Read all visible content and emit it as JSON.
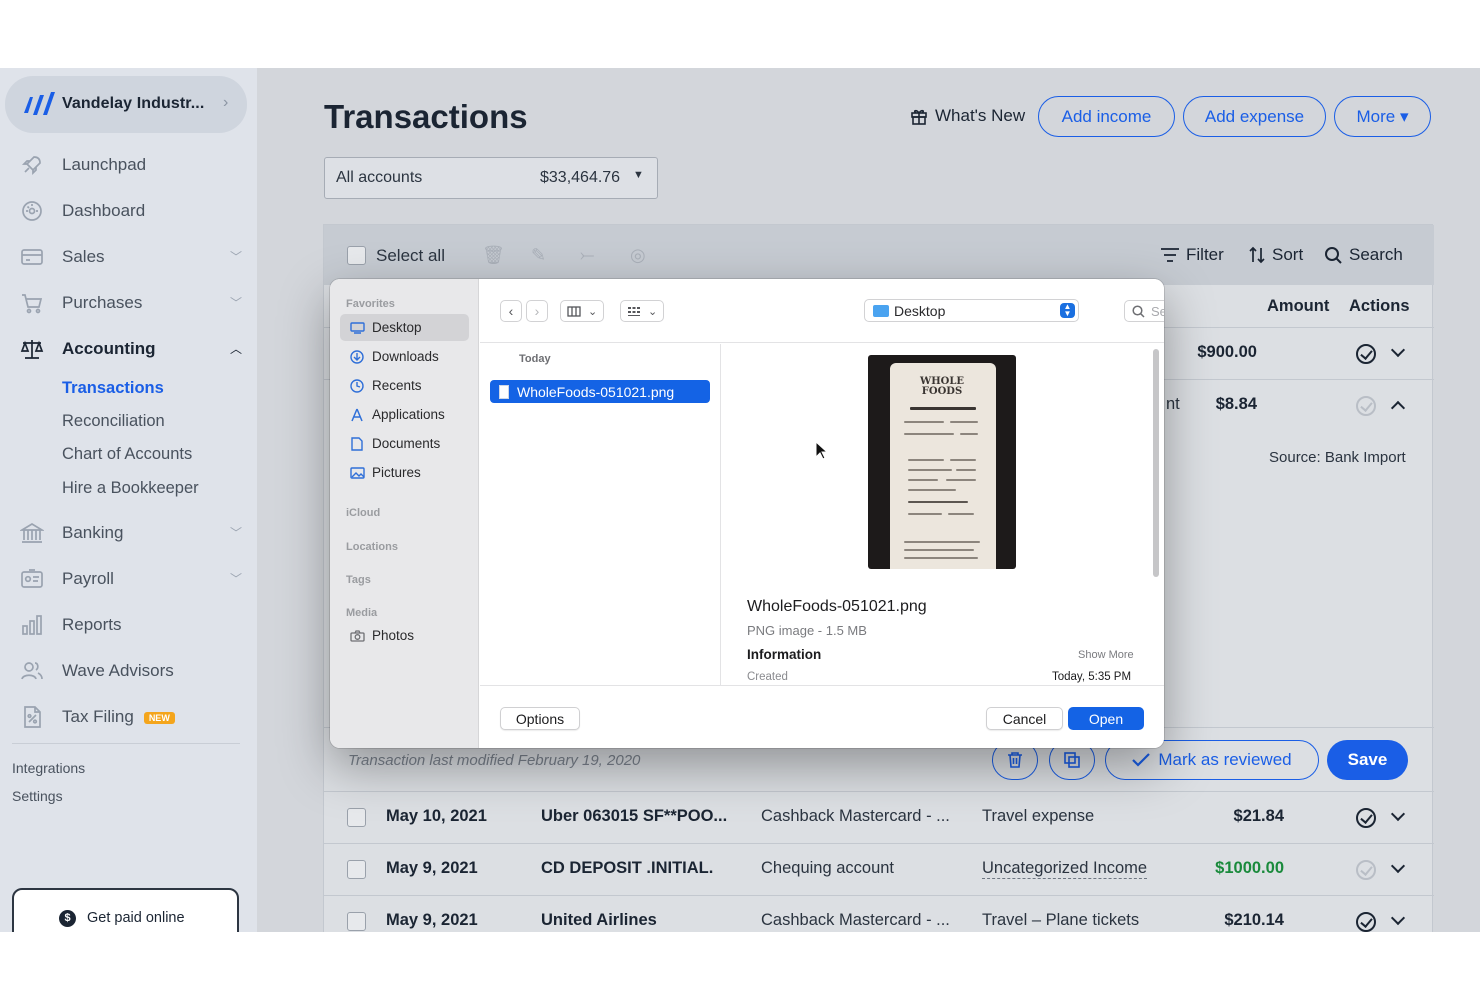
{
  "app": {
    "business_name": "Vandelay Industr...",
    "accent_color": "#1a5ee6"
  },
  "sidebar": {
    "items": [
      {
        "label": "Launchpad",
        "icon": "rocket-icon"
      },
      {
        "label": "Dashboard",
        "icon": "dashboard-icon"
      },
      {
        "label": "Sales",
        "icon": "sales-icon"
      },
      {
        "label": "Purchases",
        "icon": "cart-icon"
      },
      {
        "label": "Accounting",
        "icon": "scales-icon"
      },
      {
        "label": "Banking",
        "icon": "bank-icon"
      },
      {
        "label": "Payroll",
        "icon": "payroll-icon"
      },
      {
        "label": "Reports",
        "icon": "bar-chart-icon"
      },
      {
        "label": "Wave Advisors",
        "icon": "advisors-icon"
      },
      {
        "label": "Tax Filing",
        "icon": "tax-icon"
      }
    ],
    "accounting_sub": [
      "Transactions",
      "Reconciliation",
      "Chart of Accounts",
      "Hire a Bookkeeper"
    ],
    "new_badge": "NEW",
    "integrations": "Integrations",
    "settings": "Settings",
    "get_paid": "Get paid online"
  },
  "header": {
    "title": "Transactions",
    "whats_new": "What's New",
    "add_income": "Add income",
    "add_expense": "Add expense",
    "more": "More ▾"
  },
  "account_select": {
    "name": "All accounts",
    "balance": "$33,464.76"
  },
  "table": {
    "select_all": "Select all",
    "filter": "Filter",
    "sort": "Sort",
    "search": "Search",
    "col_amount": "Amount",
    "col_actions": "Actions",
    "row1_amount": "$900.00",
    "row2_partial": "nt",
    "row2_amount": "$8.84",
    "source": "Source: Bank Import",
    "last_modified": "Transaction last modified February 19, 2020",
    "mark_reviewed": "Mark as reviewed",
    "save": "Save",
    "rows": [
      {
        "date": "May 10, 2021",
        "description": "Uber 063015 SF**POO...",
        "account": "Cashback Mastercard - ...",
        "category": "Travel expense",
        "amount": "$21.84",
        "amount_color": "#1b2533"
      },
      {
        "date": "May 9, 2021",
        "description": "CD DEPOSIT .INITIAL.",
        "account": "Chequing account",
        "category": "Uncategorized Income",
        "amount": "$1000.00",
        "amount_color": "#1a8a3c"
      },
      {
        "date": "May 9, 2021",
        "description": "United Airlines",
        "account": "Cashback Mastercard - ...",
        "category": "Travel – Plane tickets",
        "amount": "$210.14",
        "amount_color": "#1b2533"
      }
    ]
  },
  "dialog": {
    "favorites": "Favorites",
    "fav_items": [
      "Desktop",
      "Downloads",
      "Recents",
      "Applications",
      "Documents",
      "Pictures"
    ],
    "icloud": "iCloud",
    "locations": "Locations",
    "tags": "Tags",
    "media": "Media",
    "photos": "Photos",
    "location": "Desktop",
    "search_placeholder": "Search",
    "today": "Today",
    "file_name": "WholeFoods-051021.png",
    "file_type": "PNG image - 1.5 MB",
    "information": "Information",
    "show_more": "Show More",
    "created_label": "Created",
    "created_value": "Today, 5:35 PM",
    "receipt_brand": "WHOLE FOODS",
    "options": "Options",
    "cancel": "Cancel",
    "open": "Open"
  }
}
